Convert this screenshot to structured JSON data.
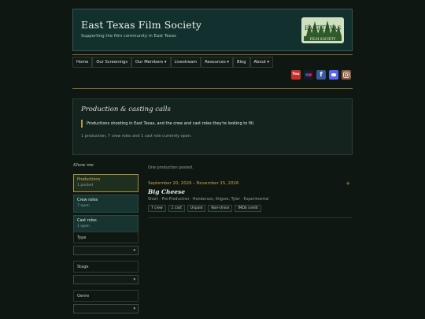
{
  "site": {
    "title": "East Texas Film Society",
    "tagline": "Supporting the film community in East Texas",
    "logo_line1": "EAST TEXAS",
    "logo_line2": "FILM SOCIETY"
  },
  "nav": {
    "items": [
      {
        "label": "Home"
      },
      {
        "label": "Our Screenings"
      },
      {
        "label": "Our Members ▾"
      },
      {
        "label": "Livestream"
      },
      {
        "label": "Resources ▾"
      },
      {
        "label": "Blog"
      },
      {
        "label": "About ▾"
      }
    ]
  },
  "social": {
    "youtube_text": "You",
    "icons": [
      "youtube-icon",
      "flickr-icon",
      "facebook-icon",
      "discord-icon",
      "instagram-icon"
    ]
  },
  "intro": {
    "heading": "Production & casting calls",
    "note": "Productions shooting in East Texas, and the crew and cast roles they're looking to fill.",
    "summary": "1 production, 7 crew roles and 1 cast role currently open."
  },
  "sidebar": {
    "heading": "Show me",
    "filters": [
      {
        "label": "Productions",
        "count": "1 posted",
        "active": true
      },
      {
        "label": "Crew roles",
        "count": "7 open",
        "active": false
      },
      {
        "label": "Cast roles",
        "count": "1 open",
        "active": false
      }
    ],
    "selects": [
      {
        "label": "Type",
        "value": ""
      },
      {
        "label": "Stage",
        "value": ""
      },
      {
        "label": "Genre",
        "value": ""
      }
    ]
  },
  "main": {
    "status": "One production posted.",
    "entries": [
      {
        "dates": "September 20, 2026 – November 15, 2026",
        "title": "Big Cheese",
        "meta": "Short · Pre-Production · Henderson, Kilgore, Tyler · Experimental",
        "tags": [
          "7 crew",
          "1 cast",
          "Unpaid",
          "Non-Union",
          "IMDb credit"
        ]
      }
    ]
  },
  "colors": {
    "accent_gold": "#c9a24a",
    "header_bg": "#11302e",
    "page_bg": "#0f1712"
  }
}
